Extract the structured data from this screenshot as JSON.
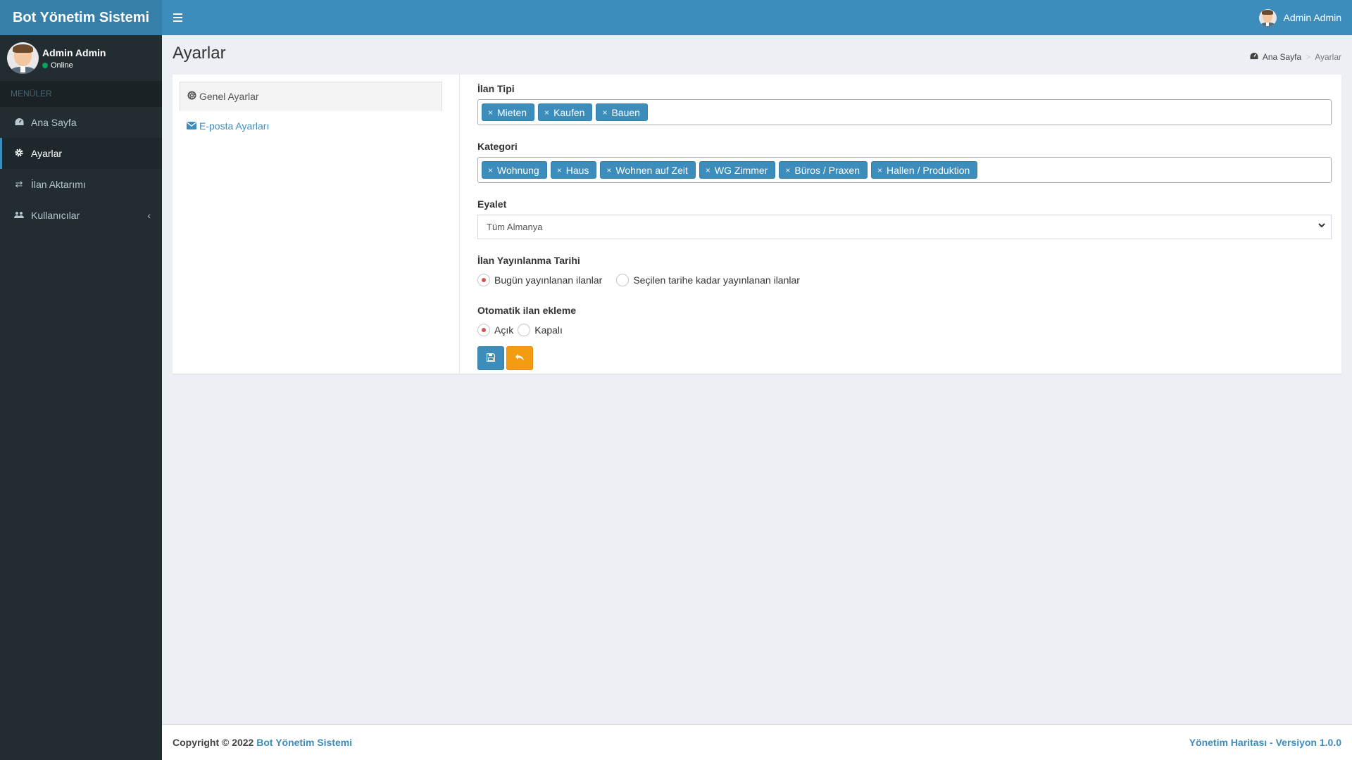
{
  "app": {
    "title": "Bot Yönetim Sistemi"
  },
  "header": {
    "user_name": "Admin Admin"
  },
  "sidebar": {
    "user": {
      "name": "Admin Admin",
      "status": "Online"
    },
    "section_header": "MENÜLER",
    "items": [
      {
        "label": "Ana Sayfa",
        "icon": "dashboard-icon"
      },
      {
        "label": "Ayarlar",
        "icon": "gear-icon",
        "active": true
      },
      {
        "label": "İlan Aktarımı",
        "icon": "exchange-icon"
      },
      {
        "label": "Kullanıcılar",
        "icon": "users-icon"
      }
    ]
  },
  "page": {
    "title": "Ayarlar",
    "breadcrumb": {
      "home": "Ana Sayfa",
      "current": "Ayarlar"
    }
  },
  "settings_nav": {
    "general": "Genel Ayarlar",
    "email": "E-posta Ayarları"
  },
  "form": {
    "listing_type": {
      "label": "İlan Tipi",
      "tags": [
        "Mieten",
        "Kaufen",
        "Bauen"
      ]
    },
    "category": {
      "label": "Kategori",
      "tags": [
        "Wohnung",
        "Haus",
        "Wohnen auf Zeit",
        "WG Zimmer",
        "Büros / Praxen",
        "Hallen / Produktion"
      ]
    },
    "state": {
      "label": "Eyalet",
      "selected": "Tüm Almanya"
    },
    "publish_date": {
      "label": "İlan Yayınlanma Tarihi",
      "option_today": "Bugün yayınlanan ilanlar",
      "option_until": "Seçilen tarihe kadar yayınlanan ilanlar",
      "selected": "today"
    },
    "auto_add": {
      "label": "Otomatik ilan ekleme",
      "option_on": "Açık",
      "option_off": "Kapalı",
      "selected": "on"
    }
  },
  "footer": {
    "copyright": "Copyright © 2022",
    "brand": "Bot Yönetim Sistemi",
    "right_text": "Yönetim Haritası -  Versiyon 1.0.0"
  },
  "colors": {
    "primary": "#3c8dbc",
    "warning": "#f39c12",
    "sidebar": "#222d32"
  }
}
